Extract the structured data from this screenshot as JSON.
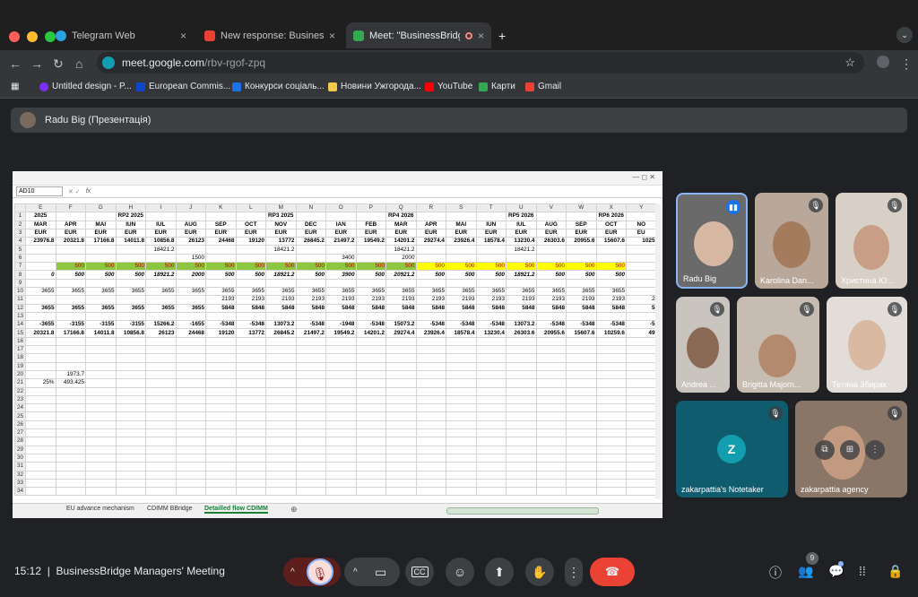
{
  "browser": {
    "tabs": [
      {
        "title": "Telegram Web",
        "close": "×"
      },
      {
        "title": "New response: BusinessBridge",
        "close": "×"
      },
      {
        "title": "Meet: \"BusinessBridge M",
        "close": "×"
      }
    ],
    "new_tab": "+",
    "url_host": "meet.google.com",
    "url_path": "/rbv-rgof-zpq",
    "bookmarks": [
      "Untitled design - P...",
      "European Commis...",
      "Конкурси соціаль...",
      "Новини Ужгорода...",
      "YouTube",
      "Карти",
      "Gmail"
    ]
  },
  "presenter": {
    "label": "Radu Big (Презентація)"
  },
  "sheet": {
    "name_box": "AD10",
    "fx": "fx",
    "col_headers": [
      "E",
      "F",
      "G",
      "H",
      "I",
      "J",
      "K",
      "L",
      "M",
      "N",
      "O",
      "P",
      "Q",
      "R",
      "S",
      "T",
      "U",
      "V",
      "W",
      "X",
      "Y"
    ],
    "rows": [
      [
        "1",
        "2025",
        "",
        "",
        "RP2 2025",
        "",
        "",
        "",
        "",
        "RP3 2025",
        "",
        "",
        "",
        "RP4 2026",
        "",
        "",
        "",
        "RP5 2026",
        "",
        "",
        "RP6 2026",
        ""
      ],
      [
        "2",
        "MAR",
        "APR",
        "MAI",
        "IUN",
        "IUL",
        "AUG",
        "SEP",
        "OCT",
        "NOV",
        "DEC",
        "IAN",
        "FEB",
        "MAR",
        "APR",
        "MAI",
        "IUN",
        "IUL",
        "AUG",
        "SEP",
        "OCT",
        "NO"
      ],
      [
        "3",
        "EUR",
        "EUR",
        "EUR",
        "EUR",
        "EUR",
        "EUR",
        "EUR",
        "EUR",
        "EUR",
        "EUR",
        "EUR",
        "EUR",
        "EUR",
        "EUR",
        "EUR",
        "EUR",
        "EUR",
        "EUR",
        "EUR",
        "EUR",
        "EU"
      ],
      [
        "4",
        "23976.8",
        "20321.8",
        "17166.8",
        "14011.8",
        "10856.8",
        "26123",
        "24468",
        "19120",
        "13772",
        "26845.2",
        "21497.2",
        "19549.2",
        "14201.2",
        "29274.4",
        "23926.4",
        "18578.4",
        "13230.4",
        "26303.6",
        "20955.6",
        "15607.6",
        "1025"
      ],
      [
        "5",
        "",
        "",
        "",
        "",
        "18421.2",
        "",
        "",
        "",
        "18421.2",
        "",
        "",
        "",
        "18421.2",
        "",
        "",
        "",
        "18421.2",
        "",
        "",
        "",
        ""
      ],
      [
        "6",
        "",
        "",
        "",
        "",
        "",
        "1500",
        "",
        "",
        "",
        "",
        "3400",
        "",
        "2000",
        "",
        "",
        "",
        "",
        "",
        "",
        "",
        ""
      ],
      [
        "7",
        "",
        "500",
        "500",
        "500",
        "500",
        "500",
        "500",
        "500",
        "500",
        "500",
        "500",
        "500",
        "500",
        "500",
        "500",
        "500",
        "500",
        "500",
        "500",
        "500",
        ""
      ],
      [
        "8",
        "0",
        "500",
        "500",
        "500",
        "18921.2",
        "2000",
        "500",
        "500",
        "18921.2",
        "500",
        "3900",
        "500",
        "20921.2",
        "500",
        "500",
        "500",
        "18921.2",
        "500",
        "500",
        "500",
        ""
      ],
      [
        "9",
        "",
        "",
        "",
        "",
        "",
        "",
        "",
        "",
        "",
        "",
        "",
        "",
        "",
        "",
        "",
        "",
        "",
        "",
        "",
        "",
        ""
      ],
      [
        "10",
        "3655",
        "3655",
        "3655",
        "3655",
        "3655",
        "3655",
        "3655",
        "3655",
        "3655",
        "3655",
        "3655",
        "3655",
        "3655",
        "3655",
        "3655",
        "3655",
        "3655",
        "3655",
        "3655",
        "3655",
        ""
      ],
      [
        "11",
        "",
        "",
        "",
        "",
        "",
        "",
        "2193",
        "2193",
        "2193",
        "2193",
        "2193",
        "2193",
        "2193",
        "2193",
        "2193",
        "2193",
        "2193",
        "2193",
        "2193",
        "2193",
        "2"
      ],
      [
        "12",
        "3655",
        "3655",
        "3655",
        "3655",
        "3655",
        "3655",
        "5848",
        "5848",
        "5848",
        "5848",
        "5848",
        "5848",
        "5848",
        "5848",
        "5848",
        "5848",
        "5848",
        "5848",
        "5848",
        "5848",
        "5"
      ],
      [
        "13",
        "",
        "",
        "",
        "",
        "",
        "",
        "",
        "",
        "",
        "",
        "",
        "",
        "",
        "",
        "",
        "",
        "",
        "",
        "",
        "",
        ""
      ],
      [
        "14",
        "-3655",
        "-3155",
        "-3155",
        "-3155",
        "15266.2",
        "-1655",
        "-5348",
        "-5348",
        "13073.2",
        "-5348",
        "-1948",
        "-5348",
        "15073.2",
        "-5348",
        "-5348",
        "-5348",
        "13073.2",
        "-5348",
        "-5348",
        "-5348",
        "-5"
      ],
      [
        "15",
        "20321.8",
        "17166.8",
        "14011.8",
        "10856.8",
        "26123",
        "24468",
        "19120",
        "13772",
        "26845.2",
        "21497.2",
        "19549.2",
        "14201.2",
        "29274.4",
        "23926.4",
        "18578.4",
        "13230.4",
        "26303.6",
        "20955.6",
        "15607.6",
        "10259.6",
        "49"
      ],
      [
        "16",
        "",
        "",
        "",
        "",
        "",
        "",
        "",
        "",
        "",
        "",
        "",
        "",
        "",
        "",
        "",
        "",
        "",
        "",
        "",
        "",
        ""
      ],
      [
        "17",
        "",
        "",
        "",
        "",
        "",
        "",
        "",
        "",
        "",
        "",
        "",
        "",
        "",
        "",
        "",
        "",
        "",
        "",
        "",
        "",
        ""
      ],
      [
        "18",
        "",
        "",
        "",
        "",
        "",
        "",
        "",
        "",
        "",
        "",
        "",
        "",
        "",
        "",
        "",
        "",
        "",
        "",
        "",
        "",
        ""
      ],
      [
        "19",
        "",
        "",
        "",
        "",
        "",
        "",
        "",
        "",
        "",
        "",
        "",
        "",
        "",
        "",
        "",
        "",
        "",
        "",
        "",
        "",
        ""
      ],
      [
        "20",
        "",
        "1973.7",
        "",
        "",
        "",
        "",
        "",
        "",
        "",
        "",
        "",
        "",
        "",
        "",
        "",
        "",
        "",
        "",
        "",
        "",
        ""
      ],
      [
        "21",
        "25%",
        "493.425",
        "",
        "",
        "",
        "",
        "",
        "",
        "",
        "",
        "",
        "",
        "",
        "",
        "",
        "",
        "",
        "",
        "",
        "",
        ""
      ],
      [
        "22",
        "",
        "",
        "",
        "",
        "",
        "",
        "",
        "",
        "",
        "",
        "",
        "",
        "",
        "",
        "",
        "",
        "",
        "",
        "",
        "",
        ""
      ],
      [
        "23",
        "",
        "",
        "",
        "",
        "",
        "",
        "",
        "",
        "",
        "",
        "",
        "",
        "",
        "",
        "",
        "",
        "",
        "",
        "",
        "",
        ""
      ],
      [
        "24",
        "",
        "",
        "",
        "",
        "",
        "",
        "",
        "",
        "",
        "",
        "",
        "",
        "",
        "",
        "",
        "",
        "",
        "",
        "",
        "",
        ""
      ],
      [
        "25",
        "",
        "",
        "",
        "",
        "",
        "",
        "",
        "",
        "",
        "",
        "",
        "",
        "",
        "",
        "",
        "",
        "",
        "",
        "",
        "",
        ""
      ],
      [
        "26",
        "",
        "",
        "",
        "",
        "",
        "",
        "",
        "",
        "",
        "",
        "",
        "",
        "",
        "",
        "",
        "",
        "",
        "",
        "",
        "",
        ""
      ],
      [
        "27",
        "",
        "",
        "",
        "",
        "",
        "",
        "",
        "",
        "",
        "",
        "",
        "",
        "",
        "",
        "",
        "",
        "",
        "",
        "",
        "",
        ""
      ],
      [
        "28",
        "",
        "",
        "",
        "",
        "",
        "",
        "",
        "",
        "",
        "",
        "",
        "",
        "",
        "",
        "",
        "",
        "",
        "",
        "",
        "",
        ""
      ],
      [
        "29",
        "",
        "",
        "",
        "",
        "",
        "",
        "",
        "",
        "",
        "",
        "",
        "",
        "",
        "",
        "",
        "",
        "",
        "",
        "",
        "",
        ""
      ],
      [
        "30",
        "",
        "",
        "",
        "",
        "",
        "",
        "",
        "",
        "",
        "",
        "",
        "",
        "",
        "",
        "",
        "",
        "",
        "",
        "",
        "",
        ""
      ],
      [
        "31",
        "",
        "",
        "",
        "",
        "",
        "",
        "",
        "",
        "",
        "",
        "",
        "",
        "",
        "",
        "",
        "",
        "",
        "",
        "",
        "",
        ""
      ],
      [
        "32",
        "",
        "",
        "",
        "",
        "",
        "",
        "",
        "",
        "",
        "",
        "",
        "",
        "",
        "",
        "",
        "",
        "",
        "",
        "",
        "",
        ""
      ],
      [
        "33",
        "",
        "",
        "",
        "",
        "",
        "",
        "",
        "",
        "",
        "",
        "",
        "",
        "",
        "",
        "",
        "",
        "",
        "",
        "",
        "",
        ""
      ],
      [
        "34",
        "",
        "",
        "",
        "",
        "",
        "",
        "",
        "",
        "",
        "",
        "",
        "",
        "",
        "",
        "",
        "",
        "",
        "",
        "",
        "",
        ""
      ]
    ],
    "sheet_tabs": [
      "EU advance mechanism",
      "CDIMM BBridge",
      "Detailled flow CDIMM"
    ],
    "colors": {
      "green": "#8dc63f",
      "yellow": "#ffff00"
    }
  },
  "participants": [
    {
      "name": "Radu Big"
    },
    {
      "name": "Karolina Dan..."
    },
    {
      "name": "Христина Ю..."
    },
    {
      "name": "Andrea ..."
    },
    {
      "name": "Brigitta Majorn..."
    },
    {
      "name": "Тетяна Збирак"
    },
    {
      "name": "zakarpattia's Notetaker",
      "initial": "Z"
    },
    {
      "name": "zakarpattia agency"
    }
  ],
  "meeting": {
    "time": "15:12",
    "separator": "|",
    "title": "BusinessBridge Managers' Meeting",
    "people_count": "9"
  },
  "colors": {
    "end_call": "#ea4335",
    "notetaker_bg": "#0f5c6e",
    "notetaker_avatar": "#129eaf"
  }
}
